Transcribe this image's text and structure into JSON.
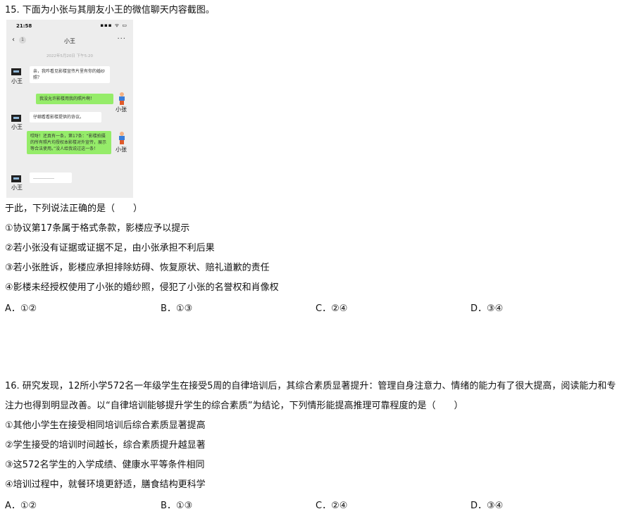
{
  "q15": {
    "title": "15. 下面为小张与其朋友小王的微信聊天内容截图。",
    "chat": {
      "time": "21:58",
      "signal": "▪▪▪ ᯤ ▭",
      "back": "‹",
      "badge": "1",
      "title": "小王",
      "more": "···",
      "timestamp": "2022年5月20日 下午5:20",
      "messages": [
        {
          "sender": "小王",
          "text": "亲，我咋看见影楼宣传片里有你的婚纱照？"
        },
        {
          "sender": "小张",
          "text": "我没允许影楼用我的照片啊！"
        },
        {
          "sender": "小王",
          "text": "仔细看看影楼提供的协议。"
        },
        {
          "sender": "小张",
          "text": "哎呀！还真有一条，第17条：“影楼拍摄的所有照片均授权本影楼对外宣传，展示等合法使用。”没人给我说过这一条！"
        },
        {
          "sender": "小王",
          "text": "……………"
        }
      ]
    },
    "stem": "于此，下列说法正确的是（　　）",
    "statements": [
      "①协议第17条属于格式条款，影楼应予以提示",
      "②若小张没有证据或证据不足，由小张承担不利后果",
      "③若小张胜诉，影楼应承担排除妨碍、恢复原状、赔礼道歉的责任",
      "④影楼未经授权使用了小张的婚纱照，侵犯了小张的名誉权和肖像权"
    ],
    "options": [
      "A．①②",
      "B．①③",
      "C．②④",
      "D．③④"
    ]
  },
  "q16": {
    "stem": "16. 研究发现，12所小学572名一年级学生在接受5周的自律培训后，其综合素质显著提升：管理自身注意力、情绪的能力有了很大提高，阅读能力和专注力也得到明显改善。以“自律培训能够提升学生的综合素质”为结论，下列情形能提高推理可靠程度的是（　　）",
    "statements": [
      "①其他小学生在接受相同培训后综合素质显著提高",
      "②学生接受的培训时间越长，综合素质提升越显著",
      "③这572名学生的入学成绩、健康水平等条件相同",
      "④培训过程中，就餐环境更舒适，膳食结构更科学"
    ],
    "options": [
      "A．①②",
      "B．①③",
      "C．②④",
      "D．③④"
    ]
  }
}
